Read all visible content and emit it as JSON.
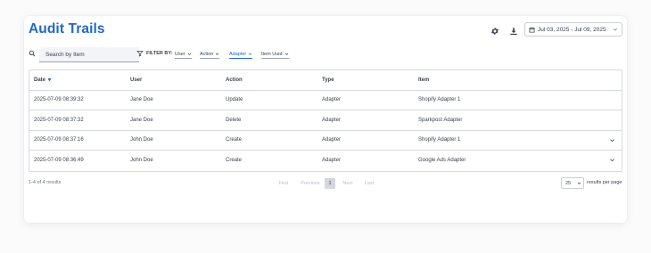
{
  "page": {
    "title": "Audit Trails",
    "date_range": "Jul 03, 2025 - Jul 09, 2025"
  },
  "toolbar": {
    "settings_icon": "gear-icon",
    "download_icon": "download-icon",
    "calendar_icon": "calendar-icon"
  },
  "search": {
    "placeholder": "Search by Item",
    "value": ""
  },
  "filters": {
    "label": "FILTER BY:",
    "chips": [
      {
        "label": "User",
        "active": false
      },
      {
        "label": "Action",
        "active": false
      },
      {
        "label": "Adapter",
        "active": true
      },
      {
        "label": "Item Uuid",
        "active": false
      }
    ]
  },
  "table": {
    "columns": [
      "Date",
      "User",
      "Action",
      "Type",
      "Item"
    ],
    "sorted_column": "Date",
    "sort_direction": "descending",
    "rows": [
      {
        "date": "2025-07-09 08:39:32",
        "user": "Jane Doe",
        "action": "Update",
        "type": "Adapter",
        "item": "Shopify Adapter 1",
        "expandable": false
      },
      {
        "date": "2025-07-09 08:37:32",
        "user": "Jane Doe",
        "action": "Delete",
        "type": "Adapter",
        "item": "Sparkpost Adapter",
        "expandable": false
      },
      {
        "date": "2025-07-09 08:37:16",
        "user": "John Doe",
        "action": "Create",
        "type": "Adapter",
        "item": "Shopify Adapter 1",
        "expandable": true
      },
      {
        "date": "2025-07-09 08:36:49",
        "user": "John Doe",
        "action": "Create",
        "type": "Adapter",
        "item": "Google Ads Adapter",
        "expandable": true
      }
    ]
  },
  "footer": {
    "count_text": "1-4 of 4 results",
    "pagination": {
      "first": "First",
      "previous": "Previous",
      "current": "1",
      "next": "Next",
      "last": "Last"
    },
    "per_page_value": "25",
    "per_page_label": "results per page"
  },
  "colors": {
    "accent": "#2368c4",
    "text": "#3b4150",
    "border": "#d6d9df",
    "disabled": "#b9bec8"
  }
}
